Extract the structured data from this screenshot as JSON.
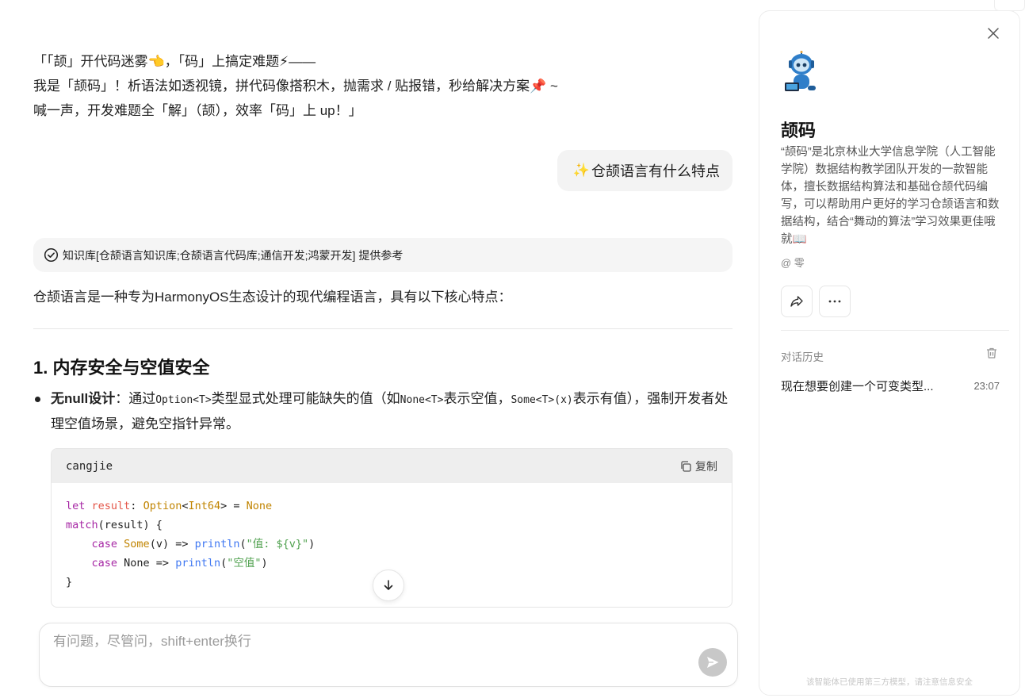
{
  "intro": {
    "line1": "「「颉」开代码迷雾👈，「码」上搞定难题⚡——",
    "line2": "我是「颉码」！析语法如透视镜，拼代码像搭积木，抛需求 / 贴报错，秒给解决方案📌 ~",
    "line3": "喊一声，开发难题全「解」（颉），效率「码」上 up！」"
  },
  "user_message": {
    "emoji": "✨",
    "text": "仓颉语言有什么特点"
  },
  "knowledge_bar": {
    "text": "知识库[仓颉语言知识库;仓颉语言代码库;通信开发;鸿蒙开发] 提供参考"
  },
  "answer": {
    "intro": "仓颉语言是一种专为HarmonyOS生态设计的现代编程语言，具有以下核心特点：",
    "heading": "1. 内存安全与空值安全",
    "bullet": {
      "bold": "无null设计",
      "t1": "：通过",
      "c1": "Option<T>",
      "t2": "类型显式处理可能缺失的值（如",
      "c2": "None<T>",
      "t3": "表示空值，",
      "c3": "Some<T>(x)",
      "t4": "表示有值），强制开发者处理空值场景，避免空指针异常。"
    },
    "code": {
      "language": "cangjie",
      "copy_label": "复制",
      "l1": {
        "kw": "let",
        "var": " result",
        "p1": ": ",
        "type1": "Option",
        "p2": "<",
        "type2": "Int64",
        "p3": "> = ",
        "none": "None"
      },
      "l2": {
        "kw": "match",
        "rest": "(result) {"
      },
      "l3": {
        "indent": "    ",
        "kw": "case",
        "sp": " ",
        "some": "Some",
        "p1": "(v) => ",
        "fn": "println",
        "p2": "(",
        "str": "\"值: ${v}\"",
        "p3": ")"
      },
      "l4": {
        "indent": "    ",
        "kw": "case",
        "rest": " None => ",
        "fn": "println",
        "p2": "(",
        "str": "\"空值\"",
        "p3": ")"
      },
      "l5": "}"
    }
  },
  "composer": {
    "placeholder": "有问题，尽管问，shift+enter换行"
  },
  "panel": {
    "bot_name": "颉码",
    "description": "“颉码”是北京林业大学信息学院（人工智能学院）数据结构教学团队开发的一款智能体，擅长数据结构算法和基础仓颉代码编写，可以帮助用户更好的学习仓颉语言和数据结构，结合“舞动的算法”学习效果更佳哦就📖",
    "author": "@ 零",
    "history_label": "对话历史",
    "history": [
      {
        "title": "现在想要创建一个可变类型...",
        "time": "23:07"
      }
    ],
    "footer_note": "该智能体已使用第三方模型，请注意信息安全"
  },
  "icons": {
    "close": "close-icon",
    "share": "share-icon",
    "more": "more-icon",
    "trash": "trash-icon",
    "copy": "copy-icon",
    "send": "send-icon",
    "scroll": "arrow-down-icon",
    "check": "check-circle-icon"
  },
  "colors": {
    "keyword": "#a626a4",
    "type": "#c18401",
    "function": "#4078f2",
    "string": "#50a14f",
    "send_button": "#c8c8c8"
  }
}
